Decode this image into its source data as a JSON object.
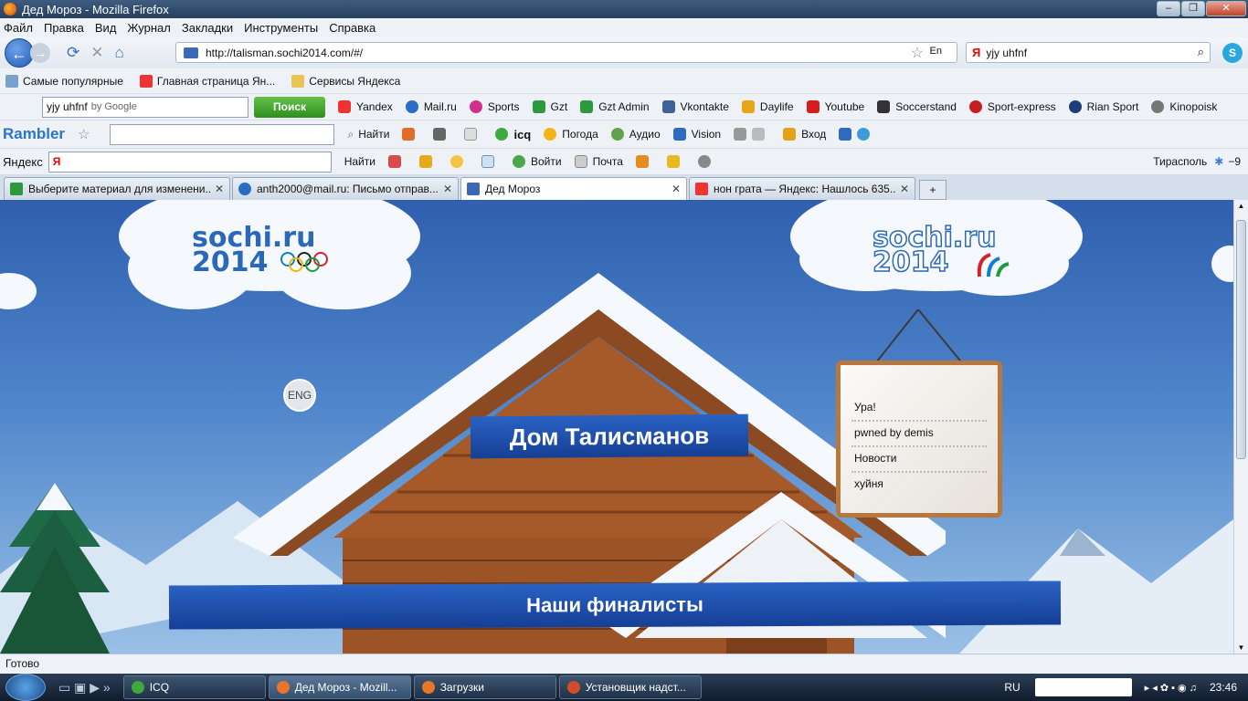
{
  "window": {
    "title": "Дед Мороз - Mozilla Firefox"
  },
  "menu": [
    "Файл",
    "Правка",
    "Вид",
    "Журнал",
    "Закладки",
    "Инструменты",
    "Справка"
  ],
  "nav": {
    "url": "http://talisman.sochi2014.com/#/",
    "lang": "En",
    "search_engine": "Я",
    "search_value": "yjy uhfnf"
  },
  "bookmarks": [
    "Самые популярные",
    "Главная страница Ян...",
    "Сервисы Яндекса"
  ],
  "google_toolbar": {
    "query": "yjy uhfnf",
    "by": "by Google",
    "button": "Поиск",
    "links": [
      "Yandex",
      "Mail.ru",
      "Sports",
      "Gzt",
      "Gzt Admin",
      "Vkontakte",
      "Daylife",
      "Youtube",
      "Soccerstand",
      "Sport-express",
      "Rian Sport",
      "Kinopoisk"
    ]
  },
  "rambler_toolbar": {
    "brand": "Rambler",
    "find": "Найти",
    "weather": "Погода",
    "audio": "Аудио",
    "vision": "Vision",
    "login": "Вход"
  },
  "yandex_toolbar": {
    "label": "Яндекс",
    "find": "Найти",
    "login": "Войти",
    "mail": "Почта",
    "city": "Тирасполь",
    "temp": "−9"
  },
  "tabs": [
    {
      "title": "Выберите материал для изменени...",
      "active": false
    },
    {
      "title": "anth2000@mail.ru: Письмо отправ...",
      "active": false
    },
    {
      "title": "Дед Мороз",
      "active": true
    },
    {
      "title": "нон грата — Яндекс: Нашлось 635...",
      "active": false
    }
  ],
  "page": {
    "logo_left": [
      "sochi.ru",
      "2014"
    ],
    "logo_right": [
      "sochi.ru",
      "2014"
    ],
    "eng": "ENG",
    "banner_title": "Дом Талисманов",
    "banner_bottom": "Наши финалисты",
    "sign_items": [
      "Ура!",
      "pwned by demis",
      "Новости",
      "хуйня"
    ]
  },
  "status": "Готово",
  "taskbar": {
    "buttons": [
      "ICQ",
      "Дед Мороз - Mozill...",
      "Загрузки",
      "Установщик надст..."
    ],
    "lang": "RU",
    "clock": "23:46"
  },
  "colors": {
    "sky_top": "#2f5fae",
    "banner": "#1f50ad",
    "sign_frame": "#b8773d",
    "wood": "#8b4a22"
  }
}
